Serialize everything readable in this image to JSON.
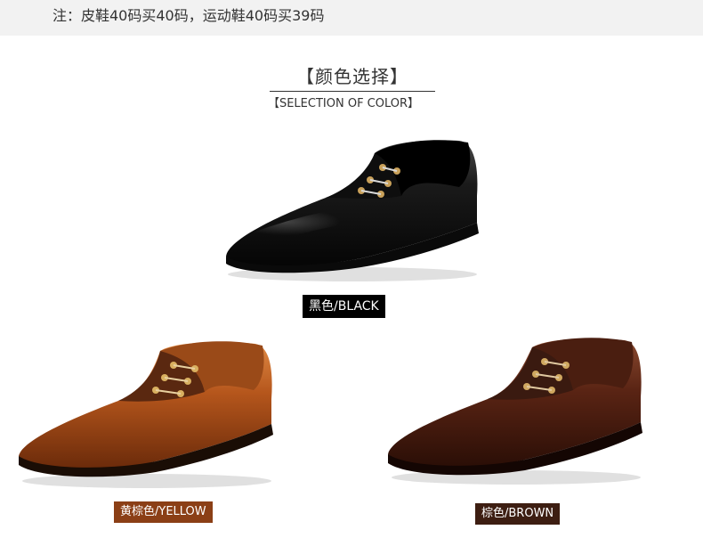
{
  "note": {
    "text": "注：皮鞋40码买40码，运动鞋40码买39码"
  },
  "section": {
    "title": "【颜色选择】",
    "subtitle": "【SELECTION OF COLOR】"
  },
  "colors": [
    {
      "label": "黑色/BLACK",
      "leather": "#111111",
      "tag_bg": "#000000"
    },
    {
      "label": "黄棕色/YELLOW",
      "leather": "#b5561c",
      "tag_bg": "#8b3f16"
    },
    {
      "label": "棕色/BROWN",
      "leather": "#5a2414",
      "tag_bg": "#3d1e12"
    }
  ]
}
